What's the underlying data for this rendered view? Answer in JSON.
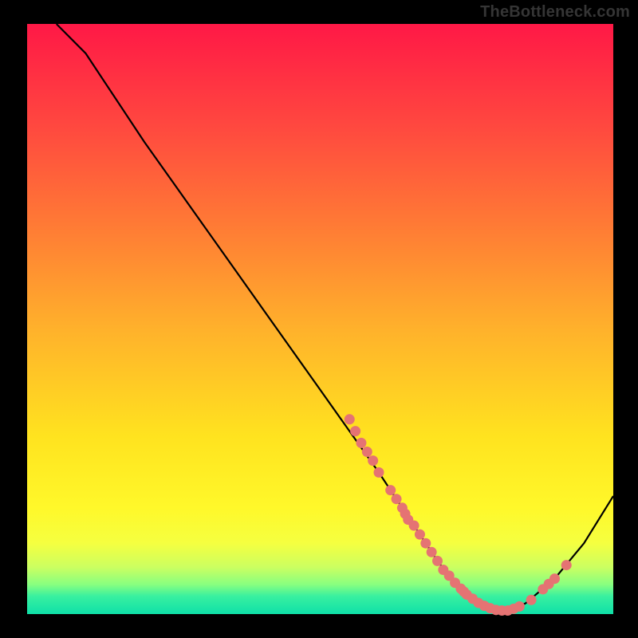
{
  "attribution": "TheBottleneck.com",
  "colors": {
    "page_bg": "#000000",
    "gradient_top": "#ff1846",
    "gradient_bottom": "#0fe0a8",
    "curve": "#000000",
    "points": "#e57373"
  },
  "chart_data": {
    "type": "line",
    "title": "",
    "xlabel": "",
    "ylabel": "",
    "xlim": [
      0,
      100
    ],
    "ylim": [
      0,
      100
    ],
    "grid": false,
    "legend": false,
    "x": [
      5,
      10,
      15,
      20,
      25,
      30,
      35,
      40,
      45,
      50,
      55,
      60,
      62,
      64,
      66,
      68,
      70,
      72,
      74,
      76,
      78,
      80,
      82,
      85,
      90,
      95,
      100
    ],
    "values": [
      100,
      95,
      87.5,
      80,
      73,
      66,
      59,
      52,
      45,
      38,
      31,
      24,
      21,
      18,
      15,
      12,
      9,
      6.5,
      4.3,
      2.6,
      1.4,
      0.6,
      0.6,
      1.8,
      6,
      12,
      20
    ],
    "scatter_points": [
      {
        "x": 55,
        "y": 33
      },
      {
        "x": 56,
        "y": 31
      },
      {
        "x": 57,
        "y": 29
      },
      {
        "x": 58,
        "y": 27.5
      },
      {
        "x": 59,
        "y": 26
      },
      {
        "x": 60,
        "y": 24
      },
      {
        "x": 62,
        "y": 21
      },
      {
        "x": 63,
        "y": 19.5
      },
      {
        "x": 64,
        "y": 18
      },
      {
        "x": 64.5,
        "y": 17
      },
      {
        "x": 65,
        "y": 16
      },
      {
        "x": 66,
        "y": 15
      },
      {
        "x": 67,
        "y": 13.5
      },
      {
        "x": 68,
        "y": 12
      },
      {
        "x": 69,
        "y": 10.5
      },
      {
        "x": 70,
        "y": 9
      },
      {
        "x": 71,
        "y": 7.5
      },
      {
        "x": 72,
        "y": 6.5
      },
      {
        "x": 73,
        "y": 5.3
      },
      {
        "x": 74,
        "y": 4.3
      },
      {
        "x": 74.5,
        "y": 3.8
      },
      {
        "x": 75,
        "y": 3.3
      },
      {
        "x": 76,
        "y": 2.6
      },
      {
        "x": 77,
        "y": 1.9
      },
      {
        "x": 78,
        "y": 1.4
      },
      {
        "x": 79,
        "y": 1
      },
      {
        "x": 80,
        "y": 0.7
      },
      {
        "x": 81,
        "y": 0.6
      },
      {
        "x": 82,
        "y": 0.6
      },
      {
        "x": 83,
        "y": 0.9
      },
      {
        "x": 84,
        "y": 1.3
      },
      {
        "x": 86,
        "y": 2.4
      },
      {
        "x": 88,
        "y": 4.2
      },
      {
        "x": 89,
        "y": 5.1
      },
      {
        "x": 90,
        "y": 6
      },
      {
        "x": 92,
        "y": 8.3
      }
    ]
  }
}
